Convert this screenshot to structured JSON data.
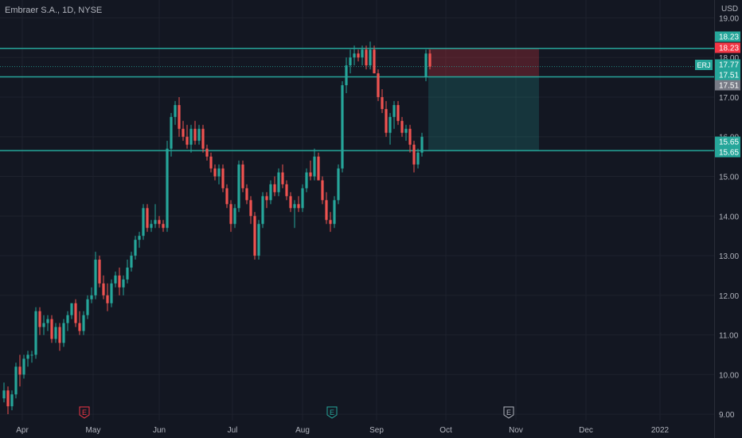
{
  "header": {
    "title": "Embraer S.A., 1D, NYSE"
  },
  "axis": {
    "currency": "USD"
  },
  "chart_data": {
    "type": "candlestick",
    "symbol": "ERJ",
    "interval": "1D",
    "exchange": "NYSE",
    "ylim": [
      8.4,
      19.45
    ],
    "y_ticks": [
      9,
      10,
      11,
      12,
      13,
      14,
      15,
      16,
      17,
      18,
      19
    ],
    "y_tick_labels": [
      "9.00",
      "10.00",
      "11.00",
      "12.00",
      "13.00",
      "14.00",
      "15.00",
      "16.00",
      "17.00",
      "18.00",
      "19.00"
    ],
    "x_labels": [
      "Apr",
      "May",
      "Jun",
      "Jul",
      "Aug",
      "Sep",
      "Oct",
      "Nov",
      "Dec",
      "2022"
    ],
    "earnings_markers": [
      {
        "label": "E",
        "date": "May"
      },
      {
        "label": "E",
        "date": "Aug"
      },
      {
        "label": "E",
        "date": "Oct"
      }
    ],
    "levels": [
      {
        "value": 18.23,
        "label": "18.23",
        "color": "#26a69a"
      },
      {
        "value": 17.51,
        "label": "17.51",
        "color": "#26a69a"
      },
      {
        "value": 15.65,
        "label": "15.65",
        "color": "#26a69a"
      }
    ],
    "price_labels": [
      {
        "value": 18.23,
        "text": "18.23",
        "color": "#26a69a"
      },
      {
        "value": 18.23,
        "text": "18.23",
        "color": "#f23645"
      },
      {
        "value": 17.77,
        "text": "17.77",
        "color": "#26a69a"
      },
      {
        "value": 17.51,
        "text": "17.51",
        "color": "#26a69a"
      },
      {
        "value": 17.51,
        "text": "17.51",
        "color": "#787b86"
      },
      {
        "value": 15.65,
        "text": "15.65",
        "color": "#26a69a"
      },
      {
        "value": 15.65,
        "text": "15.65",
        "color": "#26a69a"
      }
    ],
    "last_price": {
      "value": 17.77,
      "symbol_tag": "ERJ"
    },
    "position": {
      "entry": 17.51,
      "stop": 18.23,
      "target": 15.65
    },
    "candles": [
      [
        9.4,
        9.8,
        9.3,
        9.6
      ],
      [
        9.6,
        9.7,
        9.0,
        9.2
      ],
      [
        9.2,
        9.6,
        9.1,
        9.5
      ],
      [
        9.5,
        10.3,
        9.4,
        10.2
      ],
      [
        10.2,
        10.5,
        9.7,
        10.0
      ],
      [
        10.0,
        10.5,
        9.9,
        10.4
      ],
      [
        10.4,
        10.6,
        10.2,
        10.5
      ],
      [
        10.5,
        10.6,
        10.3,
        10.5
      ],
      [
        10.5,
        11.7,
        10.4,
        11.6
      ],
      [
        11.6,
        11.7,
        11.0,
        11.2
      ],
      [
        11.2,
        11.5,
        11.0,
        11.3
      ],
      [
        11.3,
        11.5,
        11.1,
        11.4
      ],
      [
        11.4,
        11.5,
        10.8,
        10.9
      ],
      [
        10.9,
        11.3,
        10.8,
        11.2
      ],
      [
        11.2,
        11.3,
        10.6,
        10.8
      ],
      [
        10.8,
        11.4,
        10.7,
        11.3
      ],
      [
        11.3,
        11.6,
        11.1,
        11.5
      ],
      [
        11.5,
        11.8,
        11.4,
        11.8
      ],
      [
        11.8,
        11.9,
        11.2,
        11.3
      ],
      [
        11.3,
        11.6,
        11.0,
        11.1
      ],
      [
        11.1,
        11.6,
        11.0,
        11.5
      ],
      [
        11.5,
        12.0,
        11.4,
        11.9
      ],
      [
        11.9,
        12.2,
        11.8,
        12.0
      ],
      [
        12.0,
        13.1,
        11.9,
        12.9
      ],
      [
        12.9,
        13.0,
        12.2,
        12.3
      ],
      [
        12.3,
        12.5,
        11.9,
        12.0
      ],
      [
        12.0,
        12.3,
        11.6,
        11.8
      ],
      [
        11.8,
        12.4,
        11.7,
        12.3
      ],
      [
        12.3,
        12.6,
        12.2,
        12.5
      ],
      [
        12.5,
        12.7,
        12.0,
        12.2
      ],
      [
        12.2,
        12.5,
        12.0,
        12.4
      ],
      [
        12.4,
        12.9,
        12.3,
        12.7
      ],
      [
        12.7,
        13.1,
        12.6,
        13.0
      ],
      [
        13.0,
        13.5,
        12.9,
        13.4
      ],
      [
        13.4,
        13.6,
        13.2,
        13.5
      ],
      [
        13.5,
        14.3,
        13.4,
        14.2
      ],
      [
        14.2,
        14.3,
        13.6,
        13.7
      ],
      [
        13.7,
        13.9,
        13.6,
        13.8
      ],
      [
        13.8,
        14.3,
        13.7,
        13.9
      ],
      [
        13.9,
        14.0,
        13.7,
        13.8
      ],
      [
        13.8,
        13.9,
        13.6,
        13.7
      ],
      [
        13.7,
        15.9,
        13.6,
        15.7
      ],
      [
        15.7,
        16.6,
        15.5,
        16.5
      ],
      [
        16.5,
        16.9,
        16.3,
        16.8
      ],
      [
        16.8,
        17.0,
        16.0,
        16.2
      ],
      [
        16.2,
        16.4,
        15.9,
        16.0
      ],
      [
        16.0,
        16.3,
        15.7,
        15.8
      ],
      [
        15.8,
        16.3,
        15.6,
        16.2
      ],
      [
        16.2,
        16.4,
        15.8,
        15.9
      ],
      [
        15.9,
        16.3,
        15.8,
        16.2
      ],
      [
        16.2,
        16.3,
        15.6,
        15.7
      ],
      [
        15.7,
        15.8,
        15.4,
        15.5
      ],
      [
        15.5,
        15.6,
        15.1,
        15.2
      ],
      [
        15.2,
        15.3,
        14.9,
        15.0
      ],
      [
        15.0,
        15.3,
        14.8,
        15.2
      ],
      [
        15.2,
        15.3,
        14.6,
        14.7
      ],
      [
        14.7,
        14.8,
        14.2,
        14.3
      ],
      [
        14.3,
        14.4,
        13.6,
        13.8
      ],
      [
        13.8,
        14.3,
        13.7,
        14.2
      ],
      [
        14.2,
        15.4,
        14.1,
        15.3
      ],
      [
        15.3,
        15.4,
        14.6,
        14.7
      ],
      [
        14.7,
        14.8,
        14.3,
        14.4
      ],
      [
        14.4,
        14.5,
        13.8,
        14.0
      ],
      [
        14.0,
        14.1,
        12.9,
        13.0
      ],
      [
        13.0,
        13.9,
        12.9,
        13.8
      ],
      [
        13.8,
        14.6,
        13.7,
        14.5
      ],
      [
        14.5,
        14.6,
        14.2,
        14.4
      ],
      [
        14.4,
        14.9,
        14.3,
        14.8
      ],
      [
        14.8,
        15.0,
        14.5,
        14.6
      ],
      [
        14.6,
        15.2,
        14.5,
        15.1
      ],
      [
        15.1,
        15.3,
        14.7,
        14.8
      ],
      [
        14.8,
        14.9,
        14.4,
        14.5
      ],
      [
        14.5,
        14.6,
        14.1,
        14.2
      ],
      [
        14.2,
        14.4,
        13.7,
        14.3
      ],
      [
        14.3,
        14.5,
        14.1,
        14.2
      ],
      [
        14.2,
        14.8,
        14.1,
        14.7
      ],
      [
        14.7,
        15.2,
        14.6,
        15.1
      ],
      [
        15.1,
        15.4,
        14.9,
        15.0
      ],
      [
        15.0,
        15.7,
        14.9,
        15.5
      ],
      [
        15.5,
        15.6,
        14.9,
        14.9
      ],
      [
        14.9,
        15.0,
        14.3,
        14.4
      ],
      [
        14.4,
        14.6,
        13.8,
        13.9
      ],
      [
        13.9,
        14.1,
        13.6,
        13.8
      ],
      [
        13.8,
        14.5,
        13.7,
        14.4
      ],
      [
        14.4,
        15.3,
        14.3,
        15.2
      ],
      [
        15.2,
        17.4,
        15.1,
        17.3
      ],
      [
        17.3,
        18.0,
        17.1,
        17.8
      ],
      [
        17.8,
        18.2,
        17.6,
        18.0
      ],
      [
        18.0,
        18.3,
        17.8,
        18.1
      ],
      [
        18.1,
        18.2,
        17.9,
        18.0
      ],
      [
        18.0,
        18.3,
        17.8,
        18.2
      ],
      [
        18.2,
        18.3,
        17.7,
        17.8
      ],
      [
        17.8,
        18.4,
        17.7,
        18.2
      ],
      [
        18.2,
        18.3,
        17.6,
        17.6
      ],
      [
        17.6,
        17.7,
        16.9,
        17.0
      ],
      [
        17.0,
        17.2,
        16.6,
        16.7
      ],
      [
        16.7,
        16.9,
        16.0,
        16.1
      ],
      [
        16.1,
        16.6,
        15.8,
        16.5
      ],
      [
        16.5,
        16.9,
        16.2,
        16.8
      ],
      [
        16.8,
        16.9,
        16.3,
        16.4
      ],
      [
        16.4,
        16.5,
        16.0,
        16.1
      ],
      [
        16.1,
        16.3,
        15.9,
        16.2
      ],
      [
        16.2,
        16.3,
        15.6,
        15.8
      ],
      [
        15.8,
        15.9,
        15.1,
        15.3
      ],
      [
        15.3,
        15.7,
        15.2,
        15.6
      ],
      [
        15.6,
        16.1,
        15.5,
        16.0
      ],
      [
        17.5,
        18.2,
        17.4,
        18.1
      ],
      [
        18.1,
        18.2,
        17.7,
        17.77
      ]
    ]
  }
}
